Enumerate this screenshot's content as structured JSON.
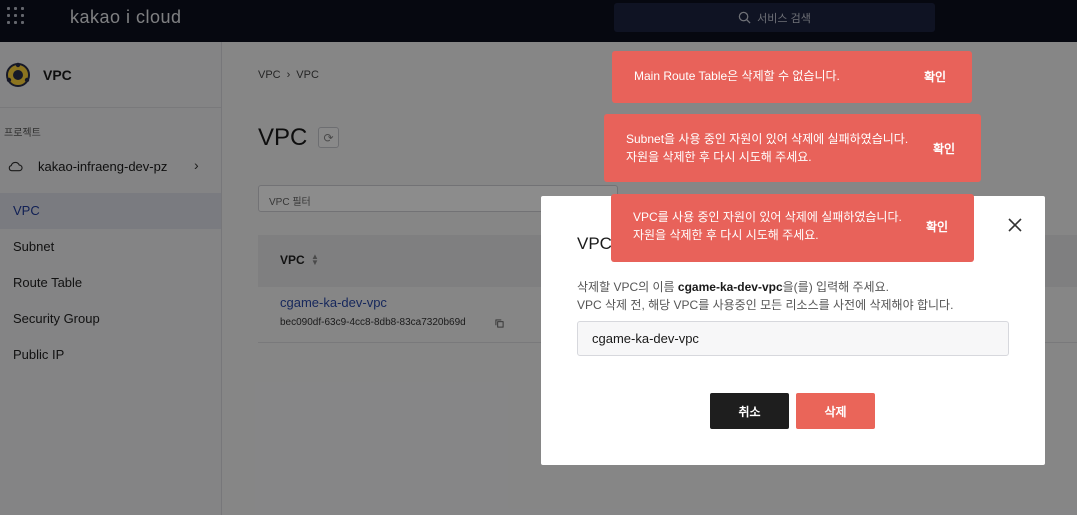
{
  "header": {
    "brand": "kakao i cloud",
    "search_label": "서비스 검색"
  },
  "sidebar": {
    "service_title": "VPC",
    "project_label": "프로젝트",
    "project_name": "kakao-infraeng-dev-pz",
    "items": [
      {
        "label": "VPC",
        "active": true
      },
      {
        "label": "Subnet"
      },
      {
        "label": "Route Table"
      },
      {
        "label": "Security Group"
      },
      {
        "label": "Public IP"
      }
    ]
  },
  "main": {
    "breadcrumb": [
      "VPC",
      "VPC"
    ],
    "breadcrumb_sep": "›",
    "page_title": "VPC",
    "filter_placeholder": "VPC 필터",
    "table": {
      "column": "VPC",
      "rows": [
        {
          "name": "cgame-ka-dev-vpc",
          "id": "bec090df-63c9-4cc8-8db8-83ca7320b69d"
        }
      ]
    }
  },
  "modal": {
    "title": "VPC",
    "desc_prefix": "삭제할 VPC의 이름 ",
    "desc_name": "cgame-ka-dev-vpc",
    "desc_suffix": "을(를) 입력해 주세요.",
    "desc2": "VPC 삭제 전, 해당 VPC를 사용중인 모든 리소스를 사전에 삭제해야 합니다.",
    "input_value": "cgame-ka-dev-vpc",
    "cancel_label": "취소",
    "delete_label": "삭제"
  },
  "toasts": [
    {
      "line1": "Main Route Table은 삭제할 수 없습니다.",
      "line2": "",
      "confirm": "확인"
    },
    {
      "line1": "Subnet을 사용 중인 자원이 있어 삭제에 실패하였습니다.",
      "line2": "자원을 삭제한 후 다시 시도해 주세요.",
      "confirm": "확인"
    },
    {
      "line1": "VPC를 사용 중인 자원이 있어 삭제에 실패하였습니다.",
      "line2": "자원을 삭제한 후 다시 시도해 주세요.",
      "confirm": "확인"
    }
  ],
  "colors": {
    "topbar": "#0b0f1e",
    "accent": "#1f3b9b",
    "danger": "#e8625a"
  }
}
